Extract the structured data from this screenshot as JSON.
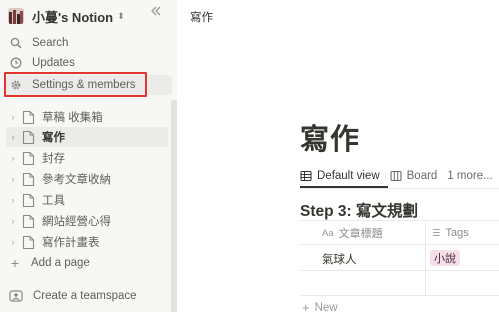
{
  "sidebar": {
    "workspace_name": "小蔓's Notion",
    "switcher_glyph": "⬍",
    "collapse_glyph": "«",
    "nav": [
      {
        "label": "Search",
        "icon": "search-icon"
      },
      {
        "label": "Updates",
        "icon": "clock-icon"
      },
      {
        "label": "Settings & members",
        "icon": "gear-icon"
      }
    ],
    "pages": [
      {
        "label": "草稿 收集箱",
        "selected": false
      },
      {
        "label": "寫作",
        "selected": true
      },
      {
        "label": "封存",
        "selected": false
      },
      {
        "label": "參考文章收納",
        "selected": false
      },
      {
        "label": "工具",
        "selected": false
      },
      {
        "label": "網站經營心得",
        "selected": false
      },
      {
        "label": "寫作計畫表",
        "selected": false
      }
    ],
    "add_page": "Add a page",
    "create_teamspace": "Create a teamspace"
  },
  "topbar": {
    "breadcrumb": "寫作"
  },
  "page": {
    "title": "寫作",
    "tabs": [
      {
        "label": "Default view",
        "icon": "table-icon",
        "active": true
      },
      {
        "label": "Board",
        "icon": "board-icon",
        "active": false
      },
      {
        "label": "1 more...",
        "icon": "",
        "active": false
      }
    ],
    "database_title": "Step 3: 寫文規劃",
    "columns": [
      {
        "label": "文章標題",
        "icon_text": "Aa"
      },
      {
        "label": "Tags",
        "icon_text": "☰"
      }
    ],
    "rows": [
      {
        "title": "氣球人",
        "tag": "小說"
      }
    ],
    "new_row": "New"
  },
  "colors": {
    "sidebar_bg": "#f7f7f5",
    "highlight_box": "#e3342f",
    "tag_bg": "#f5e0e9"
  }
}
